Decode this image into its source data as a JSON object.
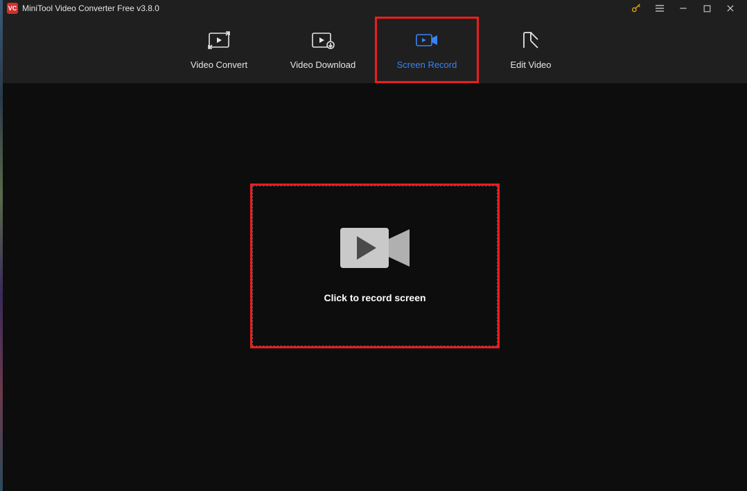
{
  "app": {
    "logo_text": "VC",
    "title": "MiniTool Video Converter Free v3.8.0"
  },
  "tabs": {
    "convert": "Video Convert",
    "download": "Video Download",
    "record": "Screen Record",
    "edit": "Edit Video"
  },
  "main": {
    "record_cta": "Click to record screen"
  }
}
